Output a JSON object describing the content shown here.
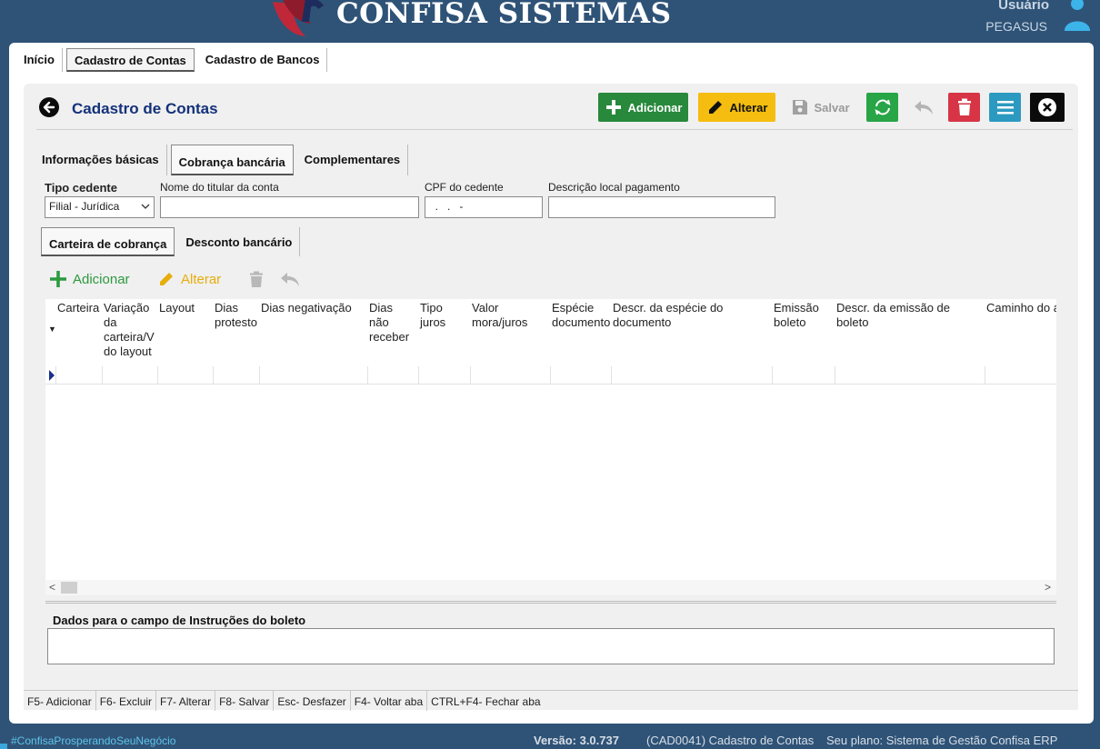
{
  "header": {
    "brand": "CONFISA SISTEMAS",
    "user_label": "Usuário",
    "user_name": "PEGASUS"
  },
  "top_tabs": [
    {
      "label": "Início",
      "active": false
    },
    {
      "label": "Cadastro de Contas",
      "active": true
    },
    {
      "label": "Cadastro de Bancos",
      "active": false
    }
  ],
  "page": {
    "title": "Cadastro de Contas"
  },
  "toolbar": {
    "add_label": "Adicionar",
    "edit_label": "Alterar",
    "save_label": "Salvar"
  },
  "section_tabs": [
    {
      "label": "Informações básicas",
      "active": false
    },
    {
      "label": "Cobrança bancária",
      "active": true
    },
    {
      "label": "Complementares",
      "active": false
    }
  ],
  "fields": {
    "tipo_cedente": {
      "label": "Tipo cedente",
      "value": "Filial - Jurídica"
    },
    "nome_titular": {
      "label": "Nome do titular da conta",
      "value": ""
    },
    "cpf_cedente": {
      "label": "CPF do cedente",
      "value": "  .   .   -"
    },
    "descricao_local": {
      "label": "Descrição local pagamento",
      "value": ""
    }
  },
  "sub_tabs": [
    {
      "label": "Carteira de cobrança",
      "active": true
    },
    {
      "label": "Desconto bancário",
      "active": false
    }
  ],
  "grid_toolbar": {
    "add_label": "Adicionar",
    "edit_label": "Alterar"
  },
  "grid": {
    "columns": [
      "Carteira",
      "Variação da carteira/V do layout",
      "Layout",
      "Dias protesto",
      "Dias negativação",
      "Dias não receber",
      "Tipo juros",
      "Valor mora/juros",
      "Espécie documento",
      "Descr. da espécie do documento",
      "Emissão boleto",
      "Descr. da emissão de boleto",
      "Caminho do a"
    ]
  },
  "instructions": {
    "label": "Dados para o campo de Instruções do boleto",
    "value": ""
  },
  "shortcuts": [
    "F5- Adicionar",
    "F6- Excluir",
    "F7- Alterar",
    "F8- Salvar",
    "Esc- Desfazer",
    "F4- Voltar aba",
    "CTRL+F4- Fechar aba"
  ],
  "footer": {
    "hashtag": "#ConfisaProsperandoSeuNegócio",
    "version": "Versão: 3.0.737",
    "module": "(CAD0041) Cadastro de Contas",
    "plan": "Seu plano: Sistema de Gestão Confisa ERP Modular"
  },
  "colors": {
    "background": "#2f5377",
    "title": "#14317a",
    "add": "#28883b",
    "edit": "#f5bd0f",
    "refresh": "#27a547",
    "delete": "#d73545",
    "menu": "#2c9ac0"
  }
}
